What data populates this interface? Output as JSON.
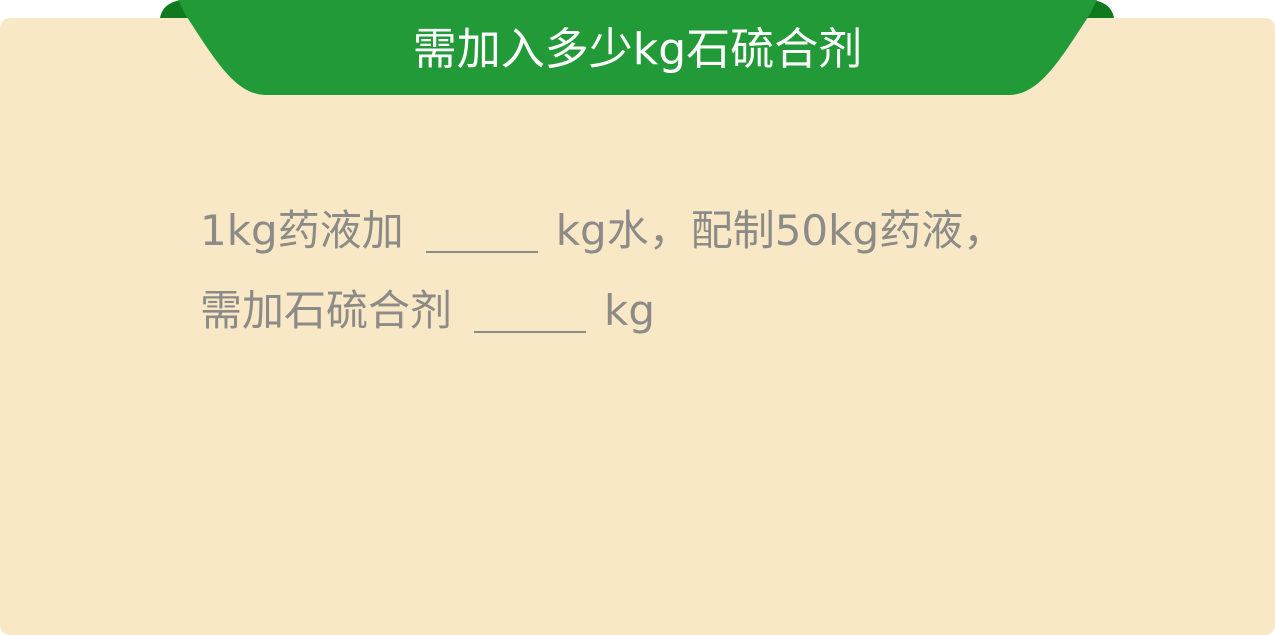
{
  "header": {
    "title": "需加入多少kg石硫合剂"
  },
  "question": {
    "line1_part1": "1kg药液加",
    "line1_part2": "kg水，配制50kg药液，",
    "line2_part1": "需加石硫合剂",
    "line2_part2": "kg"
  },
  "colors": {
    "card_background": "#f8e8c5",
    "banner_green": "#229a37",
    "banner_dark_green": "#0e7a1e",
    "text_gray": "#8c8b88"
  }
}
